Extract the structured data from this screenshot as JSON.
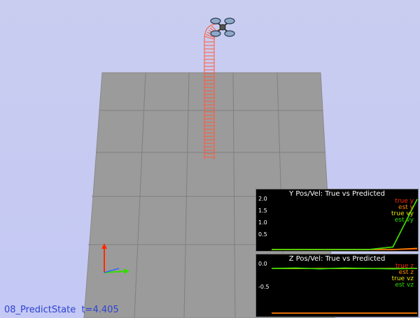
{
  "status": {
    "scenario": "08_PredictState",
    "time_text": "t=4.405"
  },
  "colors": {
    "sky": "#c6caf2",
    "ground": "#9b9b9b",
    "trajectory": "#ff5a3c",
    "red": "#ff2a00",
    "orange": "#ff8c00",
    "yellow": "#e6e600",
    "green": "#33dd00",
    "status_text": "#2e43d4"
  },
  "graphs": [
    {
      "id": "graph-y",
      "title": "Y Pos/Vel: True vs Predicted",
      "yticks": [
        "2.0",
        "1.5",
        "1.0",
        "0.5"
      ],
      "legend": [
        {
          "label": "true y",
          "color": "#ff2a00"
        },
        {
          "label": "est y",
          "color": "#ff8c00"
        },
        {
          "label": "true vy",
          "color": "#e6e600"
        },
        {
          "label": "est vy",
          "color": "#33dd00"
        }
      ]
    },
    {
      "id": "graph-z",
      "title": "Z Pos/Vel: True vs Predicted",
      "yticks": [
        "0.0",
        "-0.5"
      ],
      "legend": [
        {
          "label": "true z",
          "color": "#ff2a00"
        },
        {
          "label": "est z",
          "color": "#ff8c00"
        },
        {
          "label": "true vz",
          "color": "#e6e600"
        },
        {
          "label": "est vz",
          "color": "#33dd00"
        }
      ]
    }
  ],
  "chart_data": [
    {
      "type": "line",
      "title": "Y Pos/Vel: True vs Predicted",
      "ylim": [
        0,
        2.0
      ],
      "series": [
        {
          "name": "true y",
          "values": [
            0,
            0,
            0,
            0,
            0,
            0,
            0.02
          ]
        },
        {
          "name": "est y",
          "values": [
            0,
            0,
            0,
            0,
            0,
            0,
            0.05
          ]
        },
        {
          "name": "true vy",
          "values": [
            0,
            0,
            0,
            0,
            0,
            0.1,
            2.0
          ]
        },
        {
          "name": "est vy",
          "values": [
            0,
            0,
            0,
            0,
            0,
            0.1,
            2.0
          ]
        }
      ]
    },
    {
      "type": "line",
      "title": "Z Pos/Vel: True vs Predicted",
      "ylim": [
        -0.9,
        0.1
      ],
      "series": [
        {
          "name": "true z",
          "values": [
            -0.9,
            -0.9,
            -0.9,
            -0.9,
            -0.9,
            -0.9,
            -0.9
          ]
        },
        {
          "name": "est z",
          "values": [
            -0.9,
            -0.9,
            -0.9,
            -0.9,
            -0.9,
            -0.9,
            -0.9
          ]
        },
        {
          "name": "true vz",
          "values": [
            0,
            0,
            0,
            0,
            0,
            0,
            0
          ]
        },
        {
          "name": "est vz",
          "values": [
            0,
            0.01,
            -0.01,
            0.01,
            0,
            -0.01,
            0
          ]
        }
      ]
    }
  ]
}
